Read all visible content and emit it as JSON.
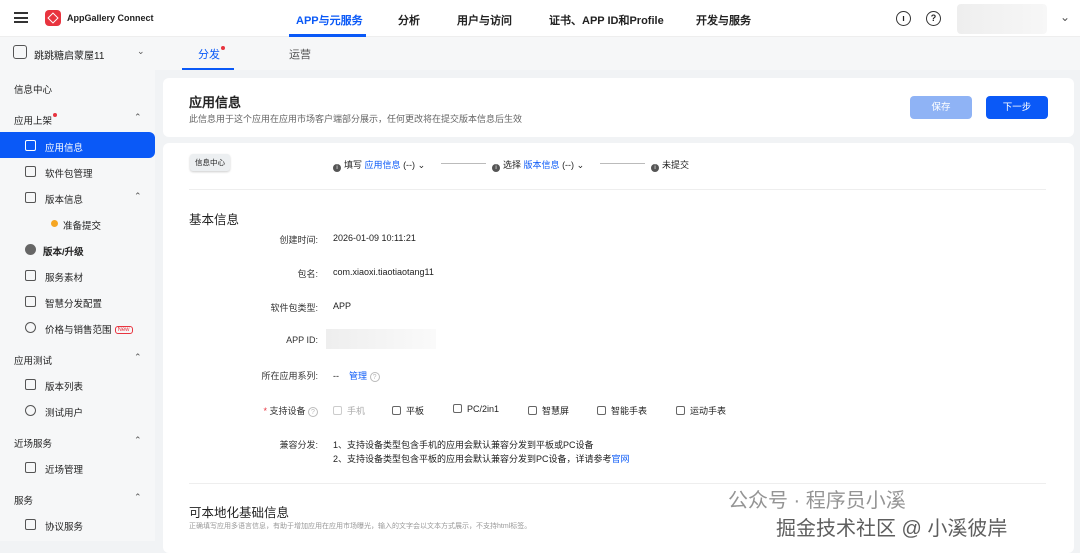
{
  "header": {
    "brand": "AppGallery Connect",
    "nav": [
      "APP与元服务",
      "分析",
      "用户与访问",
      "证书、APP ID和Profile",
      "开发与服务"
    ],
    "icons": [
      "help-icon",
      "question-icon"
    ]
  },
  "subbar": {
    "app_name": "跳跳糖启蒙屋11",
    "tabs": [
      "分发",
      "运营"
    ]
  },
  "sidebar": {
    "info_center": "信息中心",
    "groups": [
      {
        "label": "应用上架",
        "items": [
          "应用信息",
          "软件包管理",
          "版本信息",
          "准备提交",
          "版本/升级",
          "服务素材",
          "智慧分发配置",
          "价格与销售范围"
        ]
      },
      {
        "label": "应用测试",
        "items": [
          "版本列表",
          "测试用户"
        ]
      },
      {
        "label": "近场服务",
        "items": [
          "近场管理"
        ]
      },
      {
        "label": "服务",
        "items": [
          "协议服务"
        ]
      }
    ],
    "new_badge": "New"
  },
  "page": {
    "title": "应用信息",
    "desc": "此信息用于这个应用在应用市场客户端部分展示，任何更改将在提交版本信息后生效",
    "save": "保存",
    "next": "下一步"
  },
  "steps": {
    "tag": "信息中心",
    "s1_prefix": "填写",
    "s1_link": "应用信息",
    "s1_state": "(--)",
    "s2_prefix": "选择",
    "s2_link": "版本信息",
    "s2_state": "(--)",
    "s3": "未提交"
  },
  "basic": {
    "title": "基本信息",
    "created_label": "创建时间:",
    "created": "2026-01-09 10:11:21",
    "pkg_label": "包名:",
    "pkg": "com.xiaoxi.tiaotiaotang11",
    "type_label": "软件包类型:",
    "type": "APP",
    "appid_label": "APP ID:",
    "series_label": "所在应用系列:",
    "series": "--",
    "manage": "管理",
    "devices_label": "支持设备",
    "devices": [
      "手机",
      "平板",
      "PC/2in1",
      "智慧屏",
      "智能手表",
      "运动手表"
    ],
    "compat_label": "兼容分发:",
    "compat1": "1、支持设备类型包含手机的应用会默认兼容分发到平板或PC设备",
    "compat2": "2、支持设备类型包含平板的应用会默认兼容分发到PC设备，详请参考",
    "compat_link": "官网"
  },
  "local": {
    "title": "可本地化基础信息",
    "desc": "正确填写应用多语言信息，有助于增加应用在应用市场曝光，输入的文字会以文本方式展示，不支持html标签。"
  },
  "watermark": {
    "line1": "公众号 · 程序员小溪",
    "line2": "掘金技术社区 @ 小溪彼岸"
  }
}
